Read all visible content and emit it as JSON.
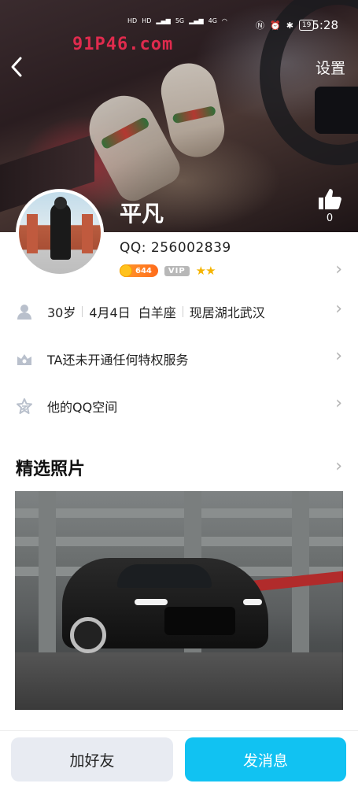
{
  "status_bar": {
    "network_labels": [
      "HD",
      "HD",
      "5G",
      "4G"
    ],
    "battery": "19",
    "time": "5:28"
  },
  "watermark": "91P46.com",
  "header": {
    "back_icon": "chevron-left-icon",
    "settings_label": "设置",
    "name": "平凡",
    "like_icon": "thumb-up-icon",
    "like_count": "0"
  },
  "profile": {
    "qq_label": "QQ:",
    "qq_number": "256002839",
    "level_value": "644",
    "vip_label": "VIP",
    "stars": "★★"
  },
  "info_rows": [
    {
      "icon": "person-icon",
      "parts": [
        "30岁",
        "4月4日",
        "白羊座",
        "现居湖北武汉"
      ]
    },
    {
      "icon": "privilege-icon",
      "text": "TA还未开通任何特权服务"
    },
    {
      "icon": "star-outline-icon",
      "text": "他的QQ空间"
    }
  ],
  "featured": {
    "title": "精选照片"
  },
  "bottom": {
    "add_friend": "加好友",
    "send_message": "发消息"
  },
  "colors": {
    "accent": "#11c2f2",
    "secondary_button": "#e8ebf2",
    "level_badge": "#ff8a22",
    "vip_badge": "#b8b8b8",
    "chevron": "#b3b3b3",
    "watermark": "#ff2d55"
  }
}
